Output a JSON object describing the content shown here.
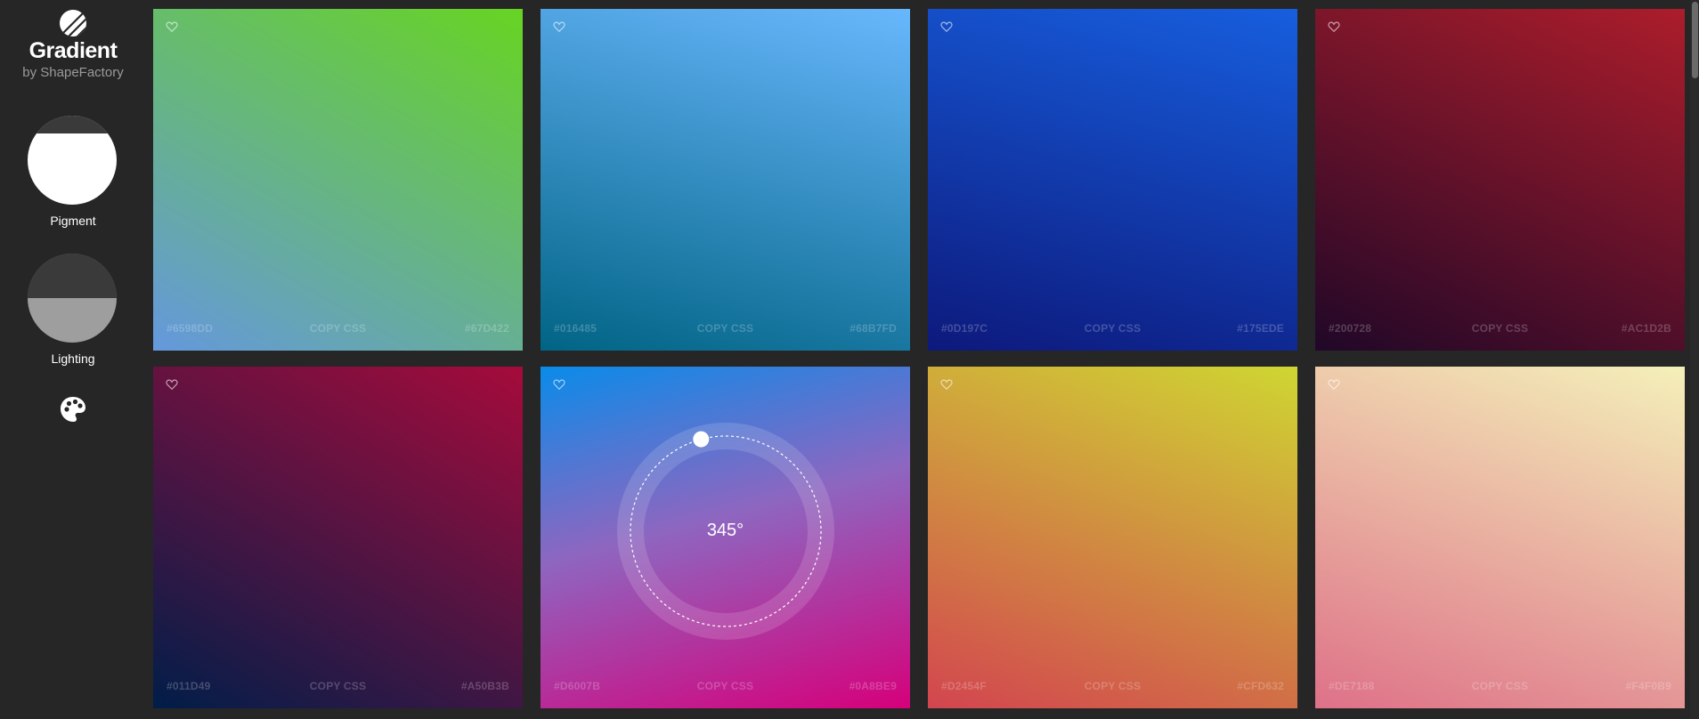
{
  "brand": {
    "title": "Gradient",
    "subtitle": "by ShapeFactory",
    "logo_icon": "logo-stripes-icon"
  },
  "modes": [
    {
      "label": "Pigment",
      "selected": true
    },
    {
      "label": "Lighting",
      "selected": false
    }
  ],
  "palette_icon": "palette-icon",
  "copy_label": "COPY CSS",
  "dial": {
    "angle_text": "345°",
    "angle": 345
  },
  "cards": [
    {
      "color_start": "#6598DD",
      "color_end": "#67D422"
    },
    {
      "color_start": "#016485",
      "color_end": "#68B7FD"
    },
    {
      "color_start": "#0D197C",
      "color_end": "#175EDE"
    },
    {
      "color_start": "#200728",
      "color_end": "#AC1D2B"
    },
    {
      "color_start": "#011D49",
      "color_end": "#A50B3B"
    },
    {
      "color_start": "#D6007B",
      "color_end": "#0A8BE9"
    },
    {
      "color_start": "#D2454F",
      "color_end": "#CFD632"
    },
    {
      "color_start": "#DE7188",
      "color_end": "#F4F0B9"
    }
  ]
}
